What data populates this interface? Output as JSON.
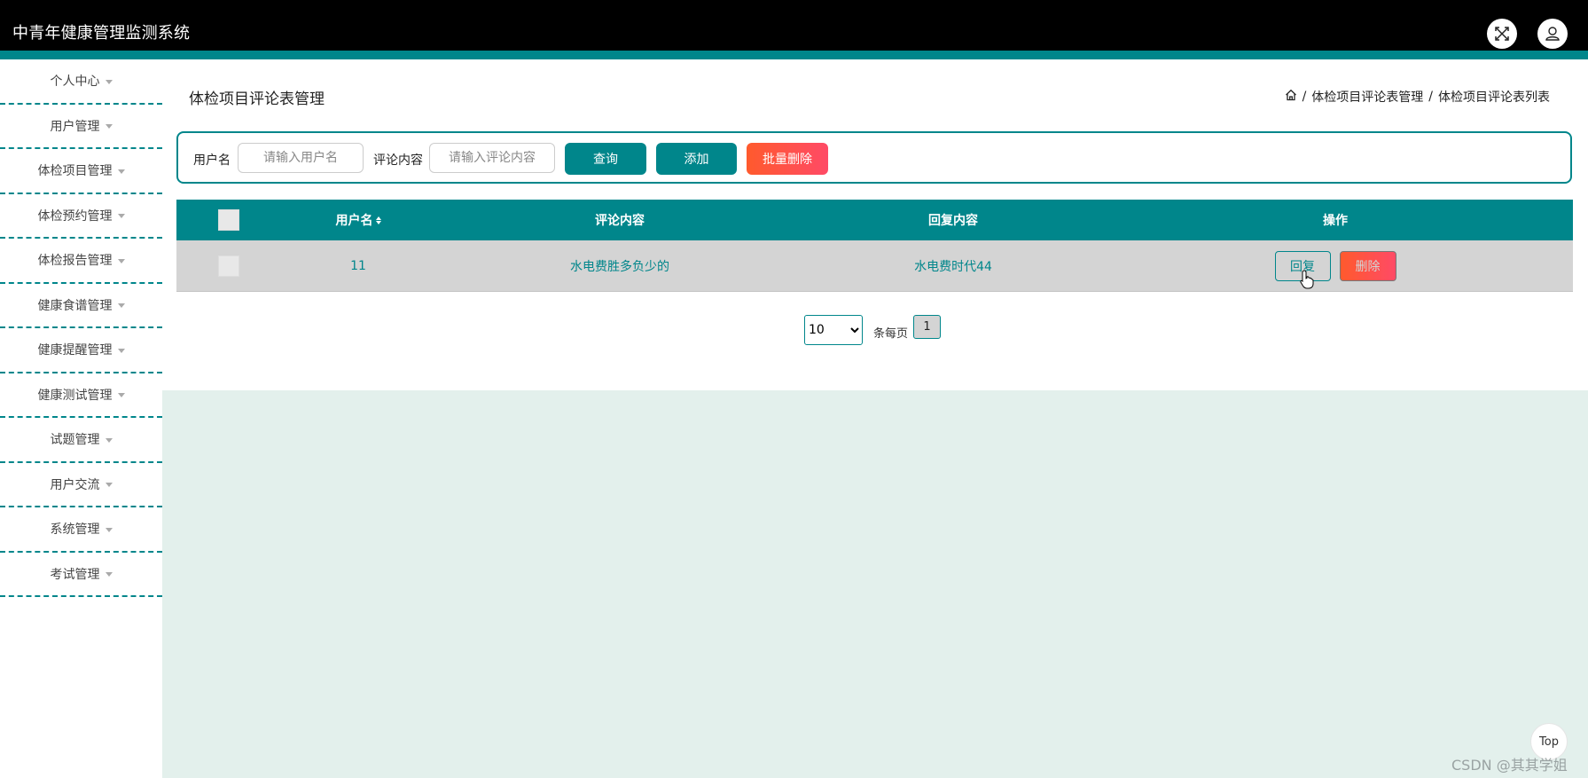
{
  "app": {
    "title": "中青年健康管理监测系统"
  },
  "header_icons": [
    "fullscreen-icon",
    "user-icon"
  ],
  "sidebar": {
    "items": [
      {
        "label": "个人中心"
      },
      {
        "label": "用户管理"
      },
      {
        "label": "体检项目管理"
      },
      {
        "label": "体检预约管理"
      },
      {
        "label": "体检报告管理"
      },
      {
        "label": "健康食谱管理"
      },
      {
        "label": "健康提醒管理"
      },
      {
        "label": "健康测试管理"
      },
      {
        "label": "试题管理"
      },
      {
        "label": "用户交流"
      },
      {
        "label": "系统管理"
      },
      {
        "label": "考试管理"
      }
    ]
  },
  "page": {
    "title": "体检项目评论表管理",
    "breadcrumb": [
      "体检项目评论表管理",
      "体检项目评论表列表"
    ],
    "separator": "/"
  },
  "search": {
    "username_label": "用户名",
    "username_placeholder": "请输入用户名",
    "comment_label": "评论内容",
    "comment_placeholder": "请输入评论内容",
    "query_button": "查询",
    "add_button": "添加",
    "batch_delete_button": "批量删除"
  },
  "table": {
    "columns": [
      "用户名",
      "评论内容",
      "回复内容",
      "操作"
    ],
    "rows": [
      {
        "username": "11",
        "comment": "水电费胜多负少的",
        "reply": "水电费时代44",
        "reply_button": "回复",
        "delete_button": "删除"
      }
    ]
  },
  "pagination": {
    "page_size": "10",
    "page_size_options": [
      "10"
    ],
    "per_page_label": "条每页",
    "current_page": "1"
  },
  "back_to_top": "Top",
  "watermark": "CSDN @其其学姐",
  "colors": {
    "primary": "#00868b",
    "danger": "#ff4a66",
    "header": "#000000",
    "content_bg": "#e3f0ec"
  }
}
